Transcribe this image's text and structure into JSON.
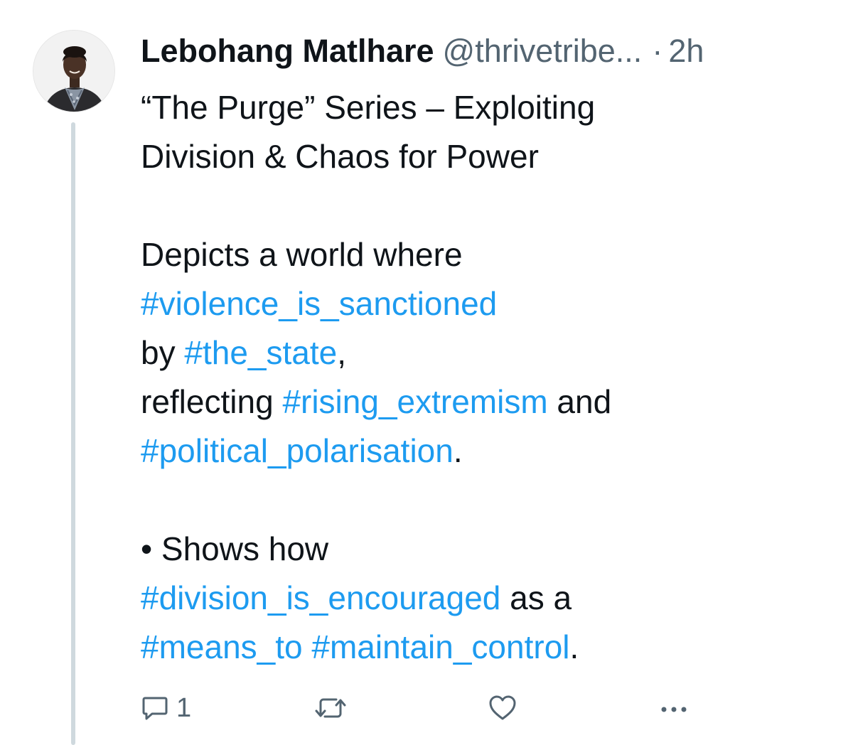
{
  "author": {
    "name": "Lebohang Matlhare",
    "handle": "@thrivetribe...",
    "separator": "·",
    "time": "2h"
  },
  "tweet": {
    "title_line1": "“The Purge” Series – Exploiting",
    "title_line2": "Division & Chaos for Power",
    "p1_line1": "Depicts a world where",
    "tag_violence": "#violence_is_sanctioned",
    "p1_by": "by ",
    "tag_state": "#the_state",
    "p1_comma": ",",
    "p1_reflecting": "reflecting ",
    "tag_extremism": "#rising_extremism",
    "p1_and": " and",
    "tag_polarisation": "#political_polarisation",
    "p1_period": ".",
    "bullet": "• Shows how",
    "tag_division": "#division_is_encouraged",
    "as_a": " as a",
    "tag_means": "#means_to",
    "space": " ",
    "tag_control": "#maintain_control",
    "final_period": "."
  },
  "actions": {
    "reply_icon": "reply-icon",
    "reply_count": "1",
    "retweet_icon": "retweet-icon",
    "like_icon": "heart-icon",
    "more_icon": "more-icon"
  },
  "colors": {
    "link": "#1d9bf0",
    "text": "#0f1419",
    "secondary": "#536471",
    "thread_line": "#cfd9de"
  }
}
